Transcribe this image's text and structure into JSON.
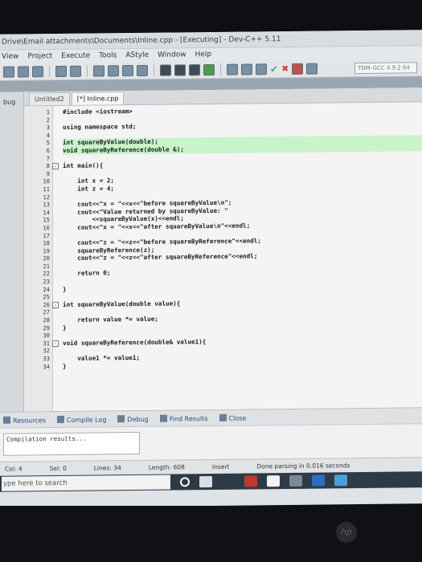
{
  "window": {
    "title": "Drive\\Email attachments\\Documents\\Inline.cpp - [Executing] - Dev-C++ 5.11"
  },
  "menu": [
    "View",
    "Project",
    "Execute",
    "Tools",
    "AStyle",
    "Window",
    "Help"
  ],
  "toolbar": {
    "compiler_combo": "TDM-GCC 4.9.2 64"
  },
  "left_panel": {
    "label": "bug"
  },
  "editor": {
    "tabs": [
      "Untitled2",
      "[*] Inline.cpp"
    ],
    "highlighted_lines": [
      5,
      6
    ],
    "lines": [
      {
        "n": "1",
        "text": "#include <iostream>"
      },
      {
        "n": "2",
        "text": ""
      },
      {
        "n": "3",
        "text": "using namespace std;"
      },
      {
        "n": "4",
        "text": ""
      },
      {
        "n": "5",
        "text": "int squareByValue(double);"
      },
      {
        "n": "6",
        "text": "void squareByReference(double &);"
      },
      {
        "n": "7",
        "text": ""
      },
      {
        "n": "8",
        "text": "int main(){",
        "fold": "-"
      },
      {
        "n": "9",
        "text": ""
      },
      {
        "n": "10",
        "text": "    int x = 2;"
      },
      {
        "n": "11",
        "text": "    int z = 4;"
      },
      {
        "n": "12",
        "text": ""
      },
      {
        "n": "13",
        "text": "    cout<<\"x = \"<<x<<\"before squareByValue\\n\";"
      },
      {
        "n": "14",
        "text": "    cout<<\"Value returned by squareByValue: \""
      },
      {
        "n": "15",
        "text": "        <<squareByValue(x)<<endl;"
      },
      {
        "n": "16",
        "text": "    cout<<\"x = \"<<x<<\"after squareByValue\\n\"<<endl;"
      },
      {
        "n": "17",
        "text": ""
      },
      {
        "n": "18",
        "text": "    cout<<\"z = \"<<z<<\"before squareByReference\"<<endl;"
      },
      {
        "n": "19",
        "text": "    squareByReference(z);"
      },
      {
        "n": "20",
        "text": "    cout<<\"z = \"<<z<<\"after squareByReference\"<<endl;"
      },
      {
        "n": "21",
        "text": ""
      },
      {
        "n": "22",
        "text": "    return 0;"
      },
      {
        "n": "23",
        "text": ""
      },
      {
        "n": "24",
        "text": "}"
      },
      {
        "n": "25",
        "text": ""
      },
      {
        "n": "26",
        "text": "int squareByValue(double value){",
        "fold": "-"
      },
      {
        "n": "27",
        "text": ""
      },
      {
        "n": "28",
        "text": "    return value *= value;"
      },
      {
        "n": "29",
        "text": "}"
      },
      {
        "n": "30",
        "text": ""
      },
      {
        "n": "31",
        "text": "void squareByReference(double& value1){",
        "fold": "-"
      },
      {
        "n": "32",
        "text": ""
      },
      {
        "n": "33",
        "text": "    value1 *= value1;"
      },
      {
        "n": "34",
        "text": "}"
      }
    ]
  },
  "bottom_tabs": [
    "Resources",
    "Compile Log",
    "Debug",
    "Find Results",
    "Close"
  ],
  "output": {
    "text": "Compilation results..."
  },
  "status": {
    "col": "Col: 4",
    "sel": "Sel: 0",
    "lines": "Lines: 34",
    "length": "Length: 608",
    "mode": "Insert",
    "message": "Done parsing in 0.016 seconds"
  },
  "taskbar": {
    "search_placeholder": "ype here to search"
  },
  "colors": {
    "highlight": "#c9f3c9",
    "gutter": "#e8e8e8",
    "editor_bg": "#f4f4f4"
  }
}
